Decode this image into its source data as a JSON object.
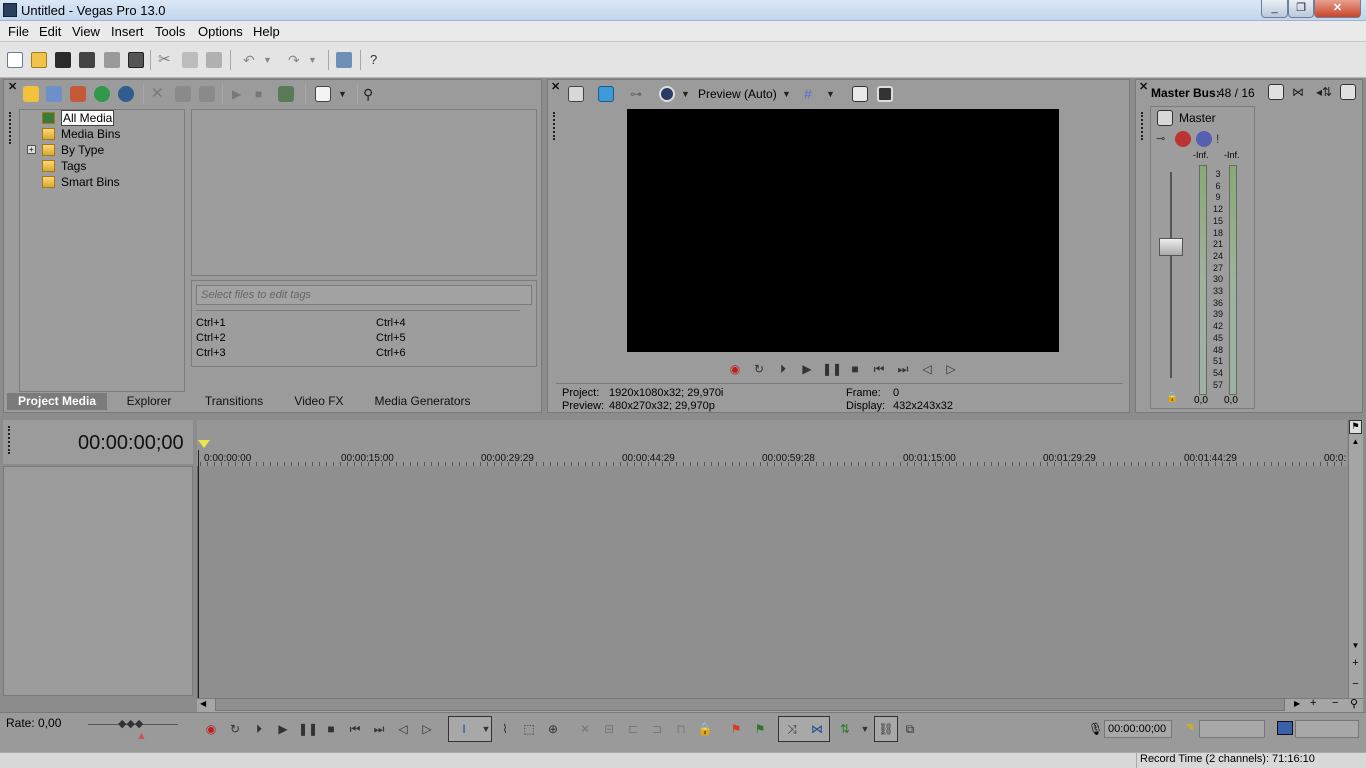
{
  "window": {
    "title": "Untitled - Vegas Pro 13.0",
    "min": "_",
    "max": "❐",
    "close": "✕"
  },
  "menu": [
    "File",
    "Edit",
    "View",
    "Insert",
    "Tools",
    "Options",
    "Help"
  ],
  "explorer": {
    "tree": [
      "All Media",
      "Media Bins",
      "By Type",
      "Tags",
      "Smart Bins"
    ],
    "expand": "+",
    "tags_placeholder": "Select files to edit tags",
    "shortcuts_left": [
      "Ctrl+1",
      "Ctrl+2",
      "Ctrl+3"
    ],
    "shortcuts_right": [
      "Ctrl+4",
      "Ctrl+5",
      "Ctrl+6"
    ],
    "tabs": [
      "Project Media",
      "Explorer",
      "Transitions",
      "Video FX",
      "Media Generators"
    ]
  },
  "preview": {
    "mode": "Preview (Auto)",
    "project_label": "Project:",
    "project_value": "1920x1080x32; 29,970i",
    "preview_label": "Preview:",
    "preview_value": "480x270x32; 29,970p",
    "frame_label": "Frame:",
    "frame_value": "0",
    "display_label": "Display:",
    "display_value": "432x243x32"
  },
  "master": {
    "title": "Master Bus:",
    "rate": "48 / 16",
    "label": "Master",
    "left_peak": "-Inf.",
    "right_peak": "-Inf.",
    "scale": [
      "3",
      "6",
      "9",
      "12",
      "15",
      "18",
      "21",
      "24",
      "27",
      "30",
      "33",
      "36",
      "39",
      "42",
      "45",
      "48",
      "51",
      "54",
      "57"
    ],
    "left_value": "0,0",
    "right_value": "0,0"
  },
  "timeline": {
    "timecode": "00:00:00;00",
    "ruler": [
      "0:00:00:00",
      "00:00:15:00",
      "00:00:29:29",
      "00:00:44:29",
      "00:00:59:28",
      "00:01:15:00",
      "00:01:29:29",
      "00:01:44:29",
      "00:0:"
    ],
    "rate": "Rate: 0,00",
    "cursor_time": "00:00:00;00",
    "record_time": "Record Time (2 channels): 71:16:10"
  },
  "colors": {
    "titlebar": "#c3d6ee",
    "panel": "#9b9b9b",
    "active_tab": "#7b7b7b",
    "record": "#d02020"
  }
}
